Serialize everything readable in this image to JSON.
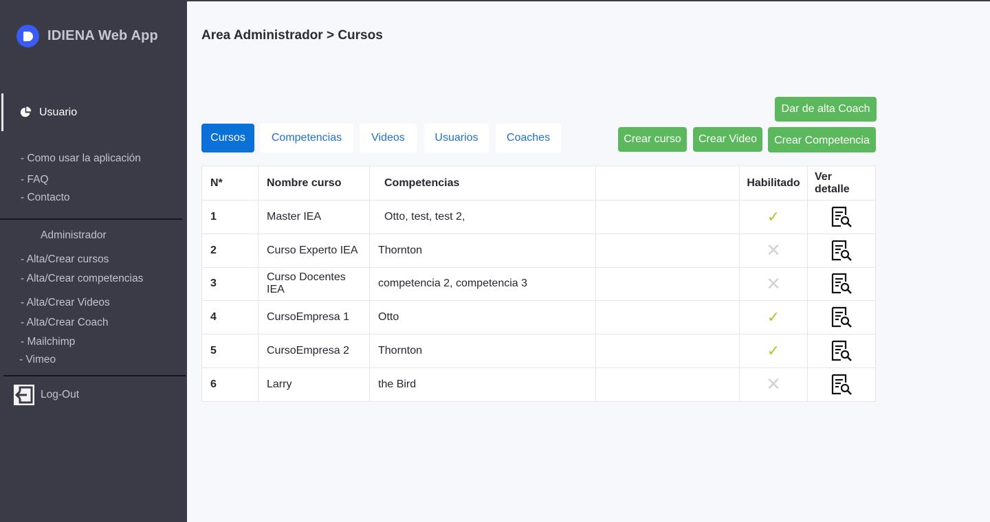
{
  "brand": {
    "name": "IDIENA Web App"
  },
  "sidebar": {
    "user_label": "Usuario",
    "help_links": [
      "- Como usar la aplicación",
      "- FAQ",
      "- Contacto"
    ],
    "admin_title": "Administrador",
    "admin_links": [
      "- Alta/Crear cursos",
      "- Alta/Crear competencias",
      "- Alta/Crear Videos",
      "- Alta/Crear Coach",
      "- Mailchimp",
      "- Vimeo"
    ],
    "logout_label": "Log-Out"
  },
  "main": {
    "title": "Area Administrador > Cursos",
    "tabs": [
      "Cursos",
      "Competencias",
      "Videos",
      "Usuarios",
      "Coaches"
    ],
    "active_tab": "Cursos",
    "buttons": {
      "add_coach": "Dar de alta Coach",
      "create_course": "Crear curso",
      "create_video": "Crear Video",
      "create_competence": "Crear Competencia"
    },
    "table": {
      "headers": [
        "N*",
        "Nombre curso",
        "Competencias",
        "",
        "Habilitado",
        "Ver detalle"
      ],
      "rows": [
        {
          "n": "1",
          "name": "Master IEA",
          "competencias": "Otto, test, test 2,",
          "enabled": true
        },
        {
          "n": "2",
          "name": "Curso Experto IEA",
          "competencias": "Thornton",
          "enabled": false
        },
        {
          "n": "3",
          "name": "Curso Docentes IEA",
          "competencias": "competencia 2, competencia 3",
          "enabled": false
        },
        {
          "n": "4",
          "name": "CursoEmpresa 1",
          "competencias": "Otto",
          "enabled": true
        },
        {
          "n": "5",
          "name": "CursoEmpresa 2",
          "competencias": "Thornton",
          "enabled": true
        },
        {
          "n": "6",
          "name": "Larry",
          "competencias": "the Bird",
          "enabled": false
        }
      ]
    }
  },
  "colors": {
    "sidebar_bg": "#3a3b46",
    "accent_blue": "#0b71d8",
    "green_button": "#5cb85c",
    "check": "#b7c22c",
    "cross": "#d3d3d6"
  },
  "icons": {
    "brand": "brand-logo-icon",
    "user": "pie-chart-icon",
    "logout": "logout-icon",
    "enabled_true": "check-icon",
    "enabled_false": "cross-icon",
    "detail": "document-search-icon"
  }
}
